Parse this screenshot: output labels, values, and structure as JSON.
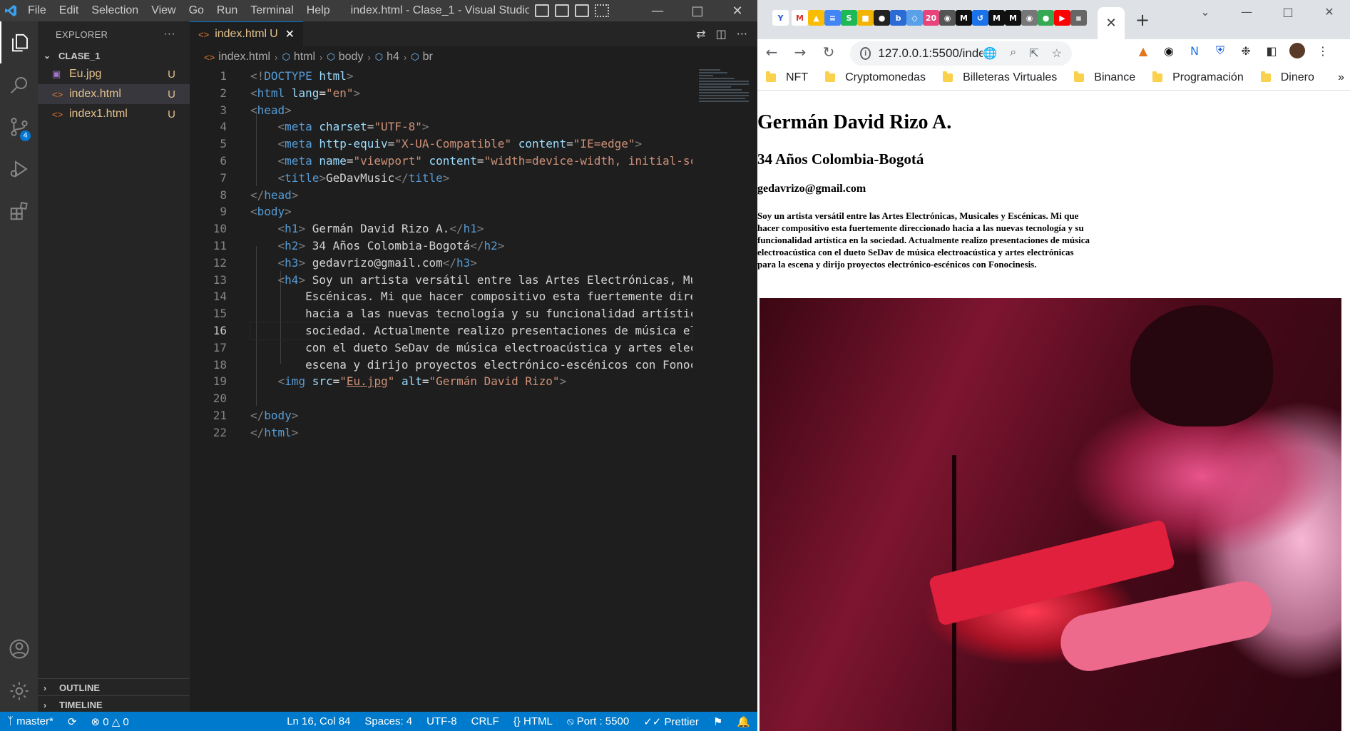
{
  "vscode": {
    "menu": [
      "File",
      "Edit",
      "Selection",
      "View",
      "Go",
      "Run",
      "Terminal",
      "Help"
    ],
    "window_title": "index.html - Clase_1 - Visual Studio ...",
    "explorer_title": "EXPLORER",
    "folder": "CLASE_1",
    "files": [
      {
        "name": "Eu.jpg",
        "status": "U",
        "icon": "image-icon"
      },
      {
        "name": "index.html",
        "status": "U",
        "icon": "html-icon",
        "selected": true
      },
      {
        "name": "index1.html",
        "status": "U",
        "icon": "html-icon"
      }
    ],
    "outline_label": "OUTLINE",
    "timeline_label": "TIMELINE",
    "source_control_badge": "4",
    "tab": {
      "name": "index.html",
      "status": "U"
    },
    "breadcrumb": [
      "index.html",
      "html",
      "body",
      "h4",
      "br"
    ],
    "status": {
      "branch": "master*",
      "errors": "0",
      "warnings": "0",
      "position": "Ln 16, Col 84",
      "spaces": "Spaces: 4",
      "encoding": "UTF-8",
      "eol": "CRLF",
      "language": "HTML",
      "port": "Port : 5500",
      "prettier": "Prettier"
    }
  },
  "chrome": {
    "url": "127.0.0.1:5500/index....",
    "bookmarks": [
      "NFT",
      "Cryptomonedas",
      "Billeteras Virtuales",
      "Binance",
      "Programación",
      "Dinero"
    ],
    "page": {
      "h1": "Germán David Rizo A.",
      "h2": "34 Años Colombia-Bogotá",
      "h3": "gedavrizo@gmail.com",
      "h4": "Soy un artista versátil entre las Artes Electrónicas, Musicales y Escénicas. Mi que hacer compositivo esta fuertemente direccionado hacia a las nuevas tecnología y su funcionalidad artística en la sociedad. Actualmente realizo presentaciones de música electroacústica con el dueto SeDav de música electroacústica y artes electrónicas para la escena y dirijo proyectos electrónico-escénicos con Fonocinesis."
    }
  }
}
